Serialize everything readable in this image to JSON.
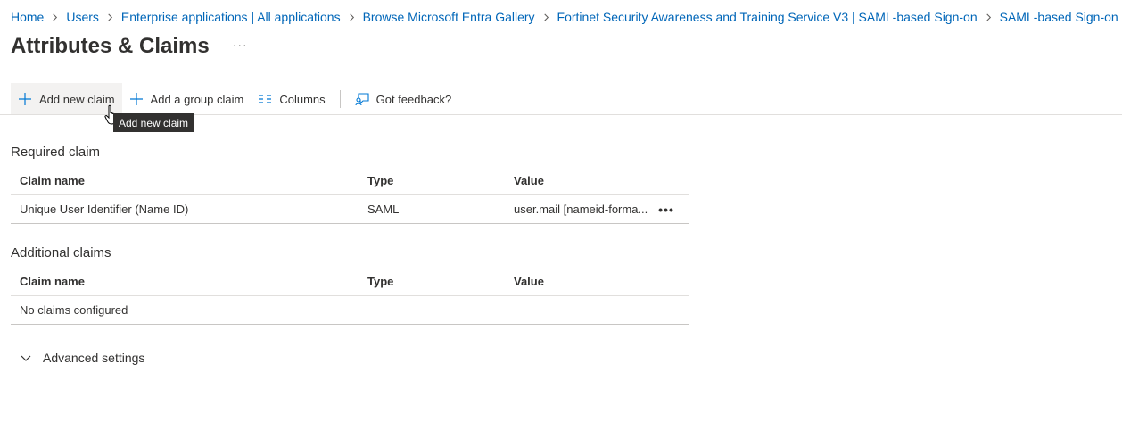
{
  "breadcrumb": {
    "items": [
      "Home",
      "Users",
      "Enterprise applications | All applications",
      "Browse Microsoft Entra Gallery",
      "Fortinet Security Awareness and Training Service V3 | SAML-based Sign-on",
      "SAML-based Sign-on"
    ]
  },
  "page": {
    "title": "Attributes & Claims",
    "more": "···"
  },
  "toolbar": {
    "add_new_claim": "Add new claim",
    "add_group_claim": "Add a group claim",
    "columns": "Columns",
    "feedback": "Got feedback?"
  },
  "tooltip": {
    "text": "Add new claim"
  },
  "required": {
    "heading": "Required claim",
    "columns": [
      "Claim name",
      "Type",
      "Value"
    ],
    "rows": [
      {
        "name": "Unique User Identifier (Name ID)",
        "type": "SAML",
        "value": "user.mail [nameid-forma...",
        "more": "•••"
      }
    ]
  },
  "additional": {
    "heading": "Additional claims",
    "columns": [
      "Claim name",
      "Type",
      "Value"
    ],
    "empty": "No claims configured"
  },
  "advanced": {
    "label": "Advanced settings"
  },
  "colors": {
    "link": "#0066b8",
    "text": "#323130",
    "border": "#e1dfdd",
    "tooltip_bg": "#323130",
    "accent_icon": "#0078d4"
  }
}
